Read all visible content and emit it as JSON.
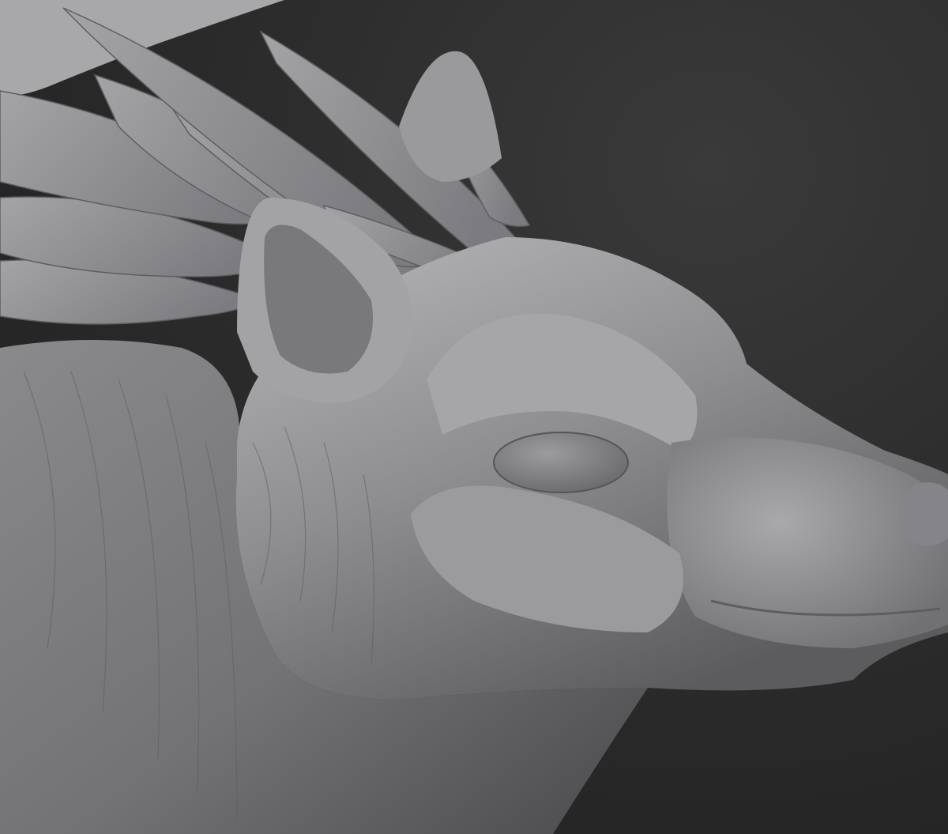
{
  "viewport": {
    "background_color": "#2b2b2b",
    "clay_color": "#8e8e90",
    "clay_highlight": "#b9b9bc",
    "clay_shadow": "#5a5a5c"
  },
  "subject": {
    "icon": "sculpt-creature-head-icon"
  }
}
